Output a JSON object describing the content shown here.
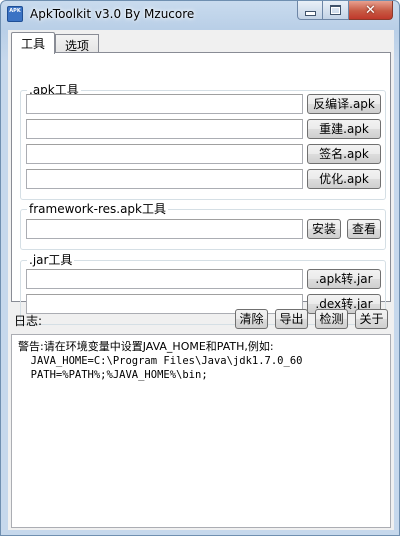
{
  "window": {
    "icon_text": "APK",
    "title": "ApkToolkit v3.0 By Mzucore"
  },
  "tabs": [
    {
      "label": "工具",
      "active": true
    },
    {
      "label": "选项",
      "active": false
    }
  ],
  "apk_group": {
    "legend": ".apk工具",
    "buttons": [
      "反编译.apk",
      "重建.apk",
      "签名.apk",
      "优化.apk"
    ]
  },
  "framework_group": {
    "legend": "framework-res.apk工具",
    "install_label": "安装",
    "view_label": "查看"
  },
  "jar_group": {
    "legend": ".jar工具",
    "buttons": [
      ".apk转.jar",
      ".dex转.jar"
    ]
  },
  "log": {
    "label": "日志:",
    "clear_label": "清除",
    "export_label": "导出",
    "check_label": "检测",
    "about_label": "关于",
    "lines": [
      "警告:请在环境变量中设置JAVA_HOME和PATH,例如:",
      "  JAVA_HOME=C:\\Program Files\\Java\\jdk1.7.0_60",
      "  PATH=%PATH%;%JAVA_HOME%\\bin;"
    ]
  }
}
